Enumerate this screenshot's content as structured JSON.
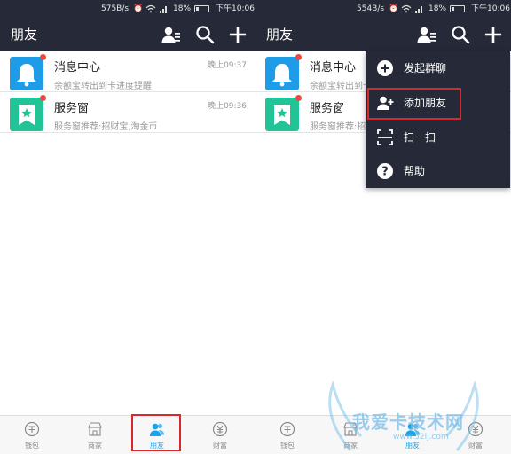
{
  "colors": {
    "header": "#262a38",
    "accent": "#1aa3e8",
    "badge": "#e84a3c",
    "highlight": "#d7292b",
    "message_icon": "#1f9ce8",
    "service_icon": "#22c497"
  },
  "screens": [
    {
      "status": {
        "net_speed": "575B/s",
        "battery": "18%",
        "time": "下午10:06"
      },
      "title": "朋友",
      "icons": [
        "contacts-icon",
        "search-icon",
        "plus-icon"
      ],
      "items": [
        {
          "title": "消息中心",
          "subtitle": "余额宝转出到卡进度提醒",
          "time": "晚上09:37",
          "icon": "bell-icon"
        },
        {
          "title": "服务窗",
          "subtitle": "服务窗推荐:招财宝,淘金币",
          "time": "晚上09:36",
          "icon": "star-bookmark-icon"
        }
      ],
      "tabs": [
        {
          "label": "钱包",
          "icon": "wallet-icon",
          "active": false
        },
        {
          "label": "商家",
          "icon": "shop-icon",
          "active": false
        },
        {
          "label": "朋友",
          "icon": "friends-icon",
          "active": true
        },
        {
          "label": "财富",
          "icon": "wealth-icon",
          "active": false
        }
      ]
    },
    {
      "status": {
        "net_speed": "554B/s",
        "battery": "18%",
        "time": "下午10:06"
      },
      "title": "朋友",
      "items": [
        {
          "title": "消息中心",
          "subtitle": "余额宝转出到卡进度提醒"
        },
        {
          "title": "服务窗",
          "subtitle": "服务窗推荐:招财宝,淘金币"
        }
      ],
      "tabs": [
        {
          "label": "钱包"
        },
        {
          "label": "商家"
        },
        {
          "label": "朋友"
        },
        {
          "label": "财富"
        }
      ],
      "menu": [
        {
          "label": "发起群聊",
          "icon": "plus-circle-icon"
        },
        {
          "label": "添加朋友",
          "icon": "add-friend-icon"
        },
        {
          "label": "扫一扫",
          "icon": "scan-icon"
        },
        {
          "label": "帮助",
          "icon": "help-icon"
        }
      ]
    }
  ],
  "watermark": {
    "text": "我爱卡技术网",
    "url": "www.52ij.com"
  }
}
